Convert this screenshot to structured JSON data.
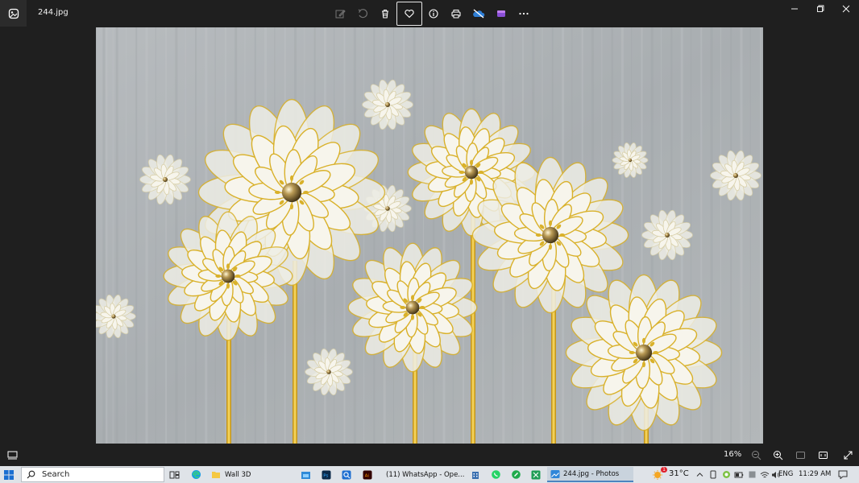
{
  "window": {
    "file_name": "244.jpg",
    "app_icon": "photos-app-icon"
  },
  "toolbar": {
    "items": [
      {
        "name": "edit-image-icon",
        "state": "disabled"
      },
      {
        "name": "rotate-icon",
        "state": "disabled"
      },
      {
        "name": "delete-icon",
        "state": "normal"
      },
      {
        "name": "favorite-heart-icon",
        "state": "selected"
      },
      {
        "name": "info-icon",
        "state": "normal"
      },
      {
        "name": "print-icon",
        "state": "normal"
      },
      {
        "name": "onedrive-icon",
        "state": "normal"
      },
      {
        "name": "clipchamp-icon",
        "state": "normal"
      },
      {
        "name": "more-options-icon",
        "state": "normal"
      }
    ]
  },
  "window_controls": [
    "minimize-icon",
    "restore-icon",
    "close-icon"
  ],
  "bottom_bar": {
    "zoom_level": "16%"
  },
  "taskbar": {
    "search_label": "Search",
    "folder_label": "Wall 3D",
    "whatsapp_label": "(11) WhatsApp - Ope...",
    "photos_label": "244.jpg - Photos",
    "weather": "31°C",
    "weather_badge": "1",
    "language": "ENG",
    "time": "11:29 AM"
  },
  "colors": {
    "chrome_bg": "#1f1f1f",
    "taskbar_bg": "#dfe3e8",
    "wall_gray": "#aeb3b6",
    "petal_white": "#f7f5ec",
    "gold": "#d9b12a"
  }
}
